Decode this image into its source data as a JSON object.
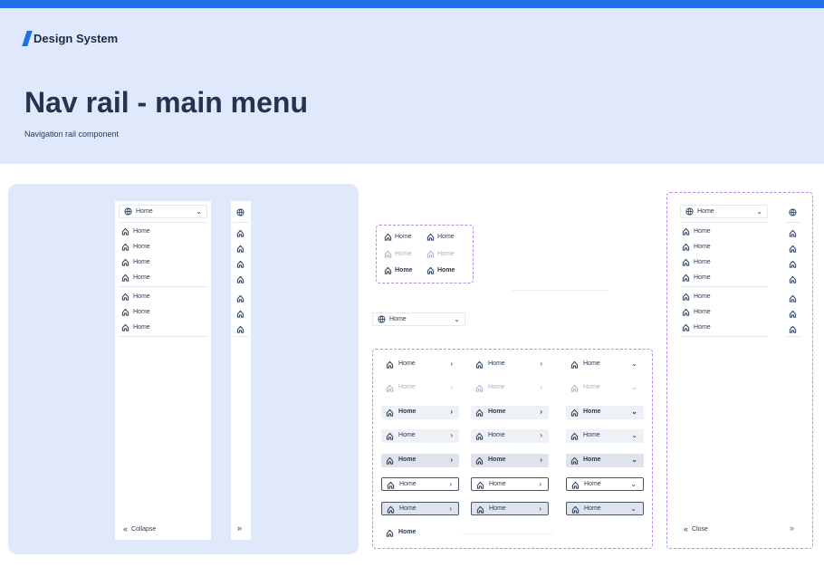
{
  "brand": {
    "name": "Design System",
    "accent": "#1f6fe5"
  },
  "header": {
    "title": "Nav rail - main menu",
    "subtitle": "Navigation rail component"
  },
  "rail": {
    "select_label": "Home",
    "group1": [
      "Home",
      "Home",
      "Home",
      "Home"
    ],
    "group2": [
      "Home",
      "Home",
      "Home"
    ],
    "collapse_label": "Collapse"
  },
  "states": {
    "item_label": "Home"
  },
  "dropdown": {
    "label": "Home"
  },
  "variants": {
    "item_label": "Home"
  },
  "rail_right": {
    "select_label": "Home",
    "group1": [
      "Home",
      "Home",
      "Home",
      "Home"
    ],
    "group2": [
      "Home",
      "Home",
      "Home"
    ],
    "close_label": "Close"
  },
  "icons": {
    "home": "home-icon",
    "globe": "globe-icon",
    "chevron": "chevron-down-icon",
    "arrow": "chevron-right-icon",
    "collapse": "double-chevron-left-icon",
    "expand": "double-chevron-right-icon"
  }
}
